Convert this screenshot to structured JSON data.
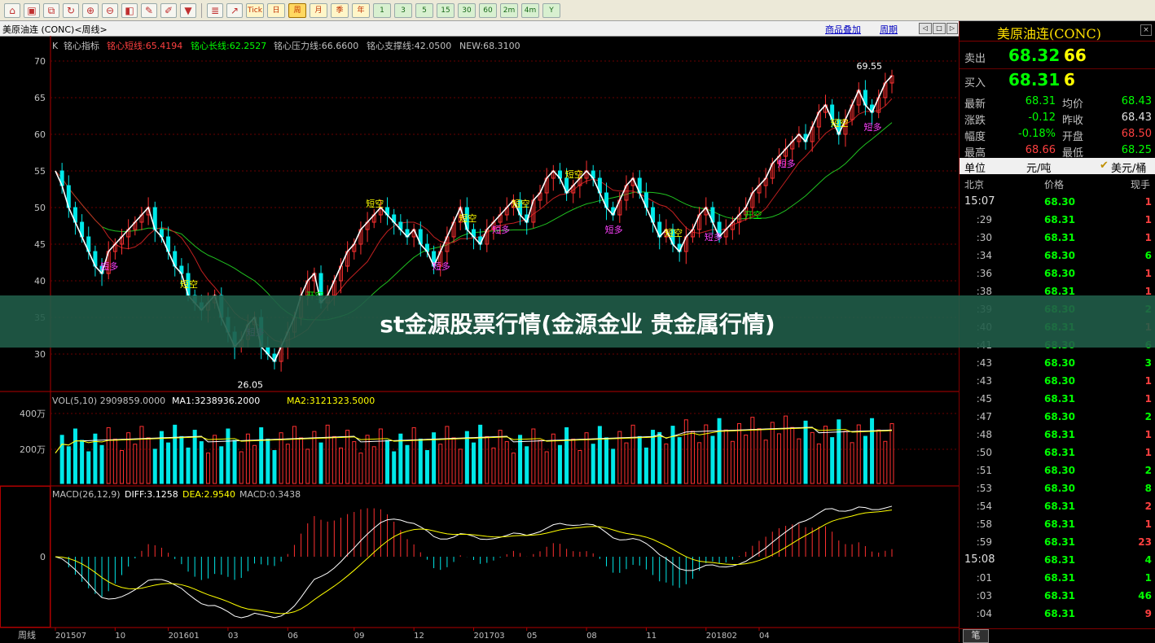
{
  "toolbar": {
    "icons": [
      "home-icon",
      "square-icon",
      "diagonal-chart-icon",
      "refresh-icon",
      "zoom-in-icon",
      "zoom-out-icon",
      "window-icon",
      "pencil-icon",
      "brush-icon",
      "funnel-icon"
    ],
    "period_buttons": [
      "Tick",
      "日",
      "周",
      "月",
      "季",
      "年",
      "1",
      "3",
      "5",
      "15",
      "30",
      "60",
      "2m",
      "4m",
      "Y"
    ],
    "active_period": "周"
  },
  "header": {
    "title": "美原油连 (CONC)<周线>",
    "overlay_link": "商品叠加",
    "period_link": "周期"
  },
  "price_panel": {
    "legend": {
      "k": "K",
      "indicator": "铭心指标",
      "short": "铭心短线:65.4194",
      "long": "铭心长线:62.2527",
      "resist": "铭心压力线:66.6600",
      "support": "铭心支撑线:42.0500",
      "new": "NEW:68.3100"
    },
    "y_ticks": [
      "70",
      "65",
      "60",
      "55",
      "50",
      "45",
      "40",
      "35",
      "30"
    ],
    "high_label": "69.55",
    "low_label": "26.05",
    "signals_short": "短空",
    "signals_long": "短多",
    "signal_open_short": "开空"
  },
  "volume_panel": {
    "legend_vol": "VOL(5,10) 2909859.0000",
    "legend_ma1": "MA1:3238936.2000",
    "legend_ma2": "MA2:3121323.5000",
    "y_ticks": [
      "400万",
      "200万"
    ]
  },
  "macd_panel": {
    "legend_main": "MACD(26,12,9)",
    "legend_diff": "DIFF:3.1258",
    "legend_dea": "DEA:2.9540",
    "legend_macd": "MACD:0.3438",
    "y_ticks": [
      "0"
    ]
  },
  "x_axis": {
    "period_label": "周线",
    "ticks": [
      "201507",
      "10",
      "201601",
      "03",
      "06",
      "09",
      "12",
      "201703",
      "05",
      "08",
      "11",
      "201802",
      "04"
    ]
  },
  "quote": {
    "title": "美原油连(CONC)",
    "sell": {
      "label": "卖出",
      "price": "68.32",
      "vol": "66"
    },
    "buy": {
      "label": "买入",
      "price": "68.31",
      "vol": "6"
    },
    "stats": [
      {
        "l1": "最新",
        "v1": "68.31",
        "c1": "#00ff00",
        "l2": "均价",
        "v2": "68.43",
        "c2": "#00ff00"
      },
      {
        "l1": "涨跌",
        "v1": "-0.12",
        "c1": "#00ff00",
        "l2": "昨收",
        "v2": "68.43",
        "c2": "#e0e0e0"
      },
      {
        "l1": "幅度",
        "v1": "-0.18%",
        "c1": "#00ff00",
        "l2": "开盘",
        "v2": "68.50",
        "c2": "#ff4040"
      },
      {
        "l1": "最高",
        "v1": "68.66",
        "c1": "#ff4040",
        "l2": "最低",
        "v2": "68.25",
        "c2": "#00ff00"
      }
    ],
    "unit": {
      "label": "单位",
      "value": "元/吨",
      "currency": "美元/桶"
    },
    "tick_header": {
      "col1": "北京",
      "col2": "价格",
      "col3": "现手"
    },
    "ticks": [
      {
        "t": "15:07",
        "p": "68.30",
        "v": "1",
        "vc": "#ff4040",
        "big": true
      },
      {
        "t": ":29",
        "p": "68.31",
        "v": "1",
        "vc": "#ff4040"
      },
      {
        "t": ":30",
        "p": "68.31",
        "v": "1",
        "vc": "#ff4040"
      },
      {
        "t": ":34",
        "p": "68.30",
        "v": "6",
        "vc": "#00ff00"
      },
      {
        "t": ":36",
        "p": "68.30",
        "v": "1",
        "vc": "#ff4040"
      },
      {
        "t": ":38",
        "p": "68.31",
        "v": "1",
        "vc": "#ff4040"
      },
      {
        "t": ":39",
        "p": "68.30",
        "v": "2",
        "vc": "#00ff00"
      },
      {
        "t": ":40",
        "p": "68.31",
        "v": "1",
        "vc": "#ff4040"
      },
      {
        "t": ":41",
        "p": "68.30",
        "v": "6",
        "vc": "#00ff00"
      },
      {
        "t": ":43",
        "p": "68.30",
        "v": "3",
        "vc": "#00ff00"
      },
      {
        "t": ":43",
        "p": "68.30",
        "v": "1",
        "vc": "#ff4040"
      },
      {
        "t": ":45",
        "p": "68.31",
        "v": "1",
        "vc": "#ff4040"
      },
      {
        "t": ":47",
        "p": "68.30",
        "v": "2",
        "vc": "#00ff00"
      },
      {
        "t": ":48",
        "p": "68.31",
        "v": "1",
        "vc": "#ff4040"
      },
      {
        "t": ":50",
        "p": "68.31",
        "v": "1",
        "vc": "#ff4040"
      },
      {
        "t": ":51",
        "p": "68.30",
        "v": "2",
        "vc": "#00ff00"
      },
      {
        "t": ":53",
        "p": "68.30",
        "v": "8",
        "vc": "#00ff00"
      },
      {
        "t": ":54",
        "p": "68.31",
        "v": "2",
        "vc": "#ff4040"
      },
      {
        "t": ":58",
        "p": "68.31",
        "v": "1",
        "vc": "#ff4040"
      },
      {
        "t": ":59",
        "p": "68.31",
        "v": "23",
        "vc": "#ff4040"
      },
      {
        "t": "15:08",
        "p": "68.31",
        "v": "4",
        "vc": "#00ff00",
        "big": true
      },
      {
        "t": ":01",
        "p": "68.31",
        "v": "1",
        "vc": "#00ff00"
      },
      {
        "t": ":03",
        "p": "68.31",
        "v": "46",
        "vc": "#00ff00"
      },
      {
        "t": ":04",
        "p": "68.31",
        "v": "9",
        "vc": "#ff4040"
      }
    ],
    "bottom_tab": "笔"
  },
  "banner": {
    "text": "st金源股票行情(金源金业 贵金属行情)"
  },
  "chart_data": {
    "type": "candlestick",
    "title": "美原油连 (CONC)<周线>",
    "weekly_close": [
      55,
      53,
      50,
      48,
      46,
      44,
      42,
      41,
      44,
      45,
      46,
      47,
      48,
      49,
      50,
      47,
      46,
      44,
      42,
      41,
      38,
      37,
      36,
      37,
      38,
      35,
      33,
      31,
      32,
      34,
      35,
      31,
      30,
      29,
      31,
      33,
      35,
      38,
      40,
      41,
      37,
      38,
      40,
      42,
      44,
      45,
      47,
      48,
      49,
      50,
      49,
      48,
      47,
      46,
      47,
      45,
      44,
      42,
      44,
      46,
      48,
      50,
      47,
      46,
      45,
      47,
      48,
      49,
      50,
      51,
      49,
      48,
      51,
      52,
      54,
      55,
      54,
      52,
      53,
      54,
      55,
      54,
      52,
      50,
      49,
      51,
      53,
      54,
      52,
      50,
      48,
      46,
      47,
      45,
      44,
      46,
      47,
      49,
      50,
      48,
      46,
      47,
      48,
      49,
      50,
      52,
      53,
      54,
      56,
      57,
      58,
      59,
      60,
      59,
      61,
      63,
      64,
      62,
      60,
      62,
      64,
      66,
      64,
      63,
      65,
      67,
      68
    ],
    "ylim": [
      26,
      71
    ],
    "high": 69.55,
    "low": 26.05,
    "y_ticks": [
      70,
      65,
      60,
      55,
      50,
      45,
      40,
      35,
      30
    ],
    "resistance": 66.66,
    "support": 42.05,
    "last": 68.31
  }
}
